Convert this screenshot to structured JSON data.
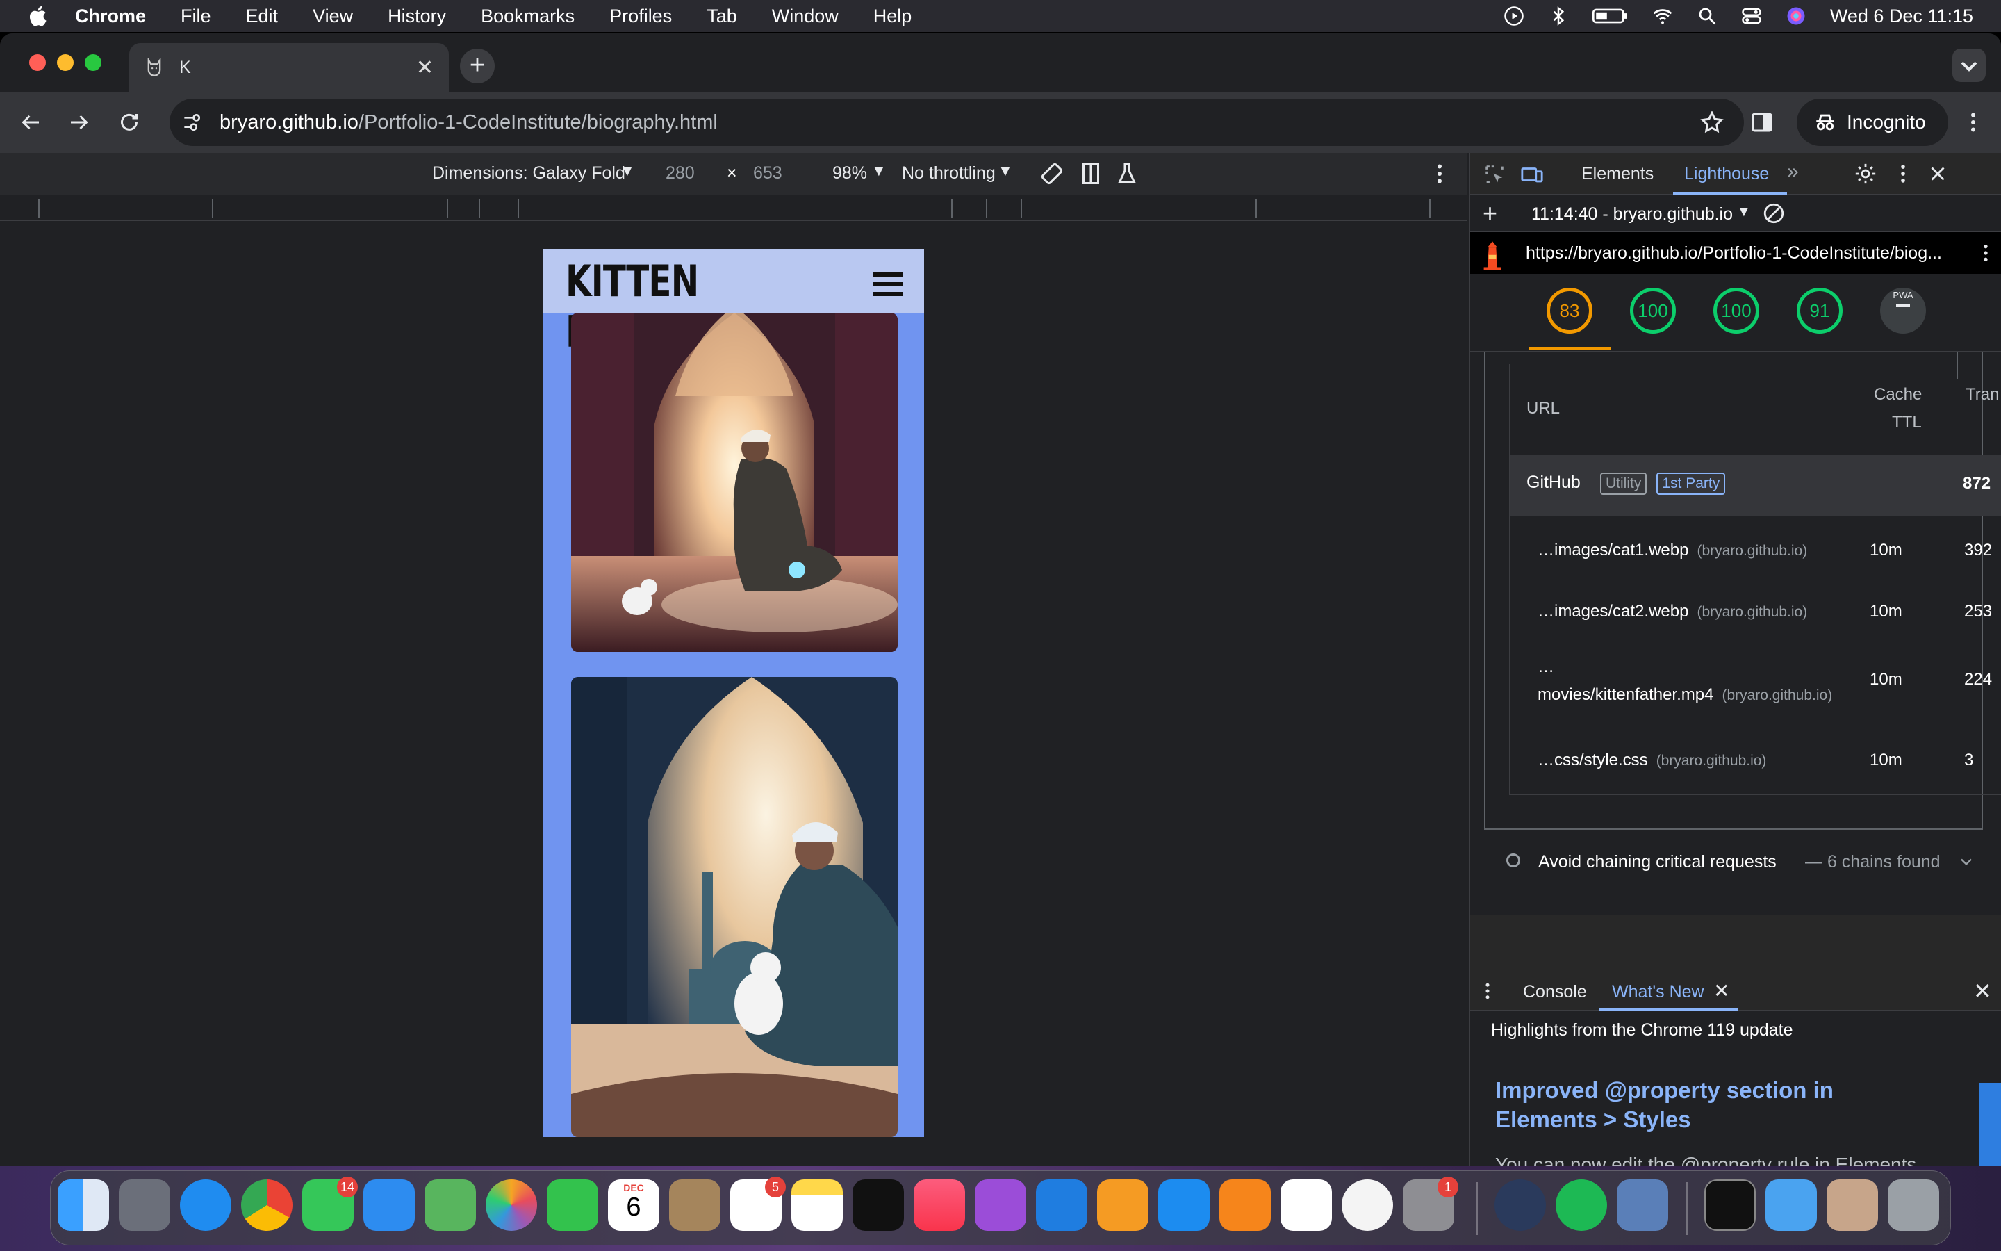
{
  "menubar": {
    "app": "Chrome",
    "items": [
      "File",
      "Edit",
      "View",
      "History",
      "Bookmarks",
      "Profiles",
      "Tab",
      "Window",
      "Help"
    ],
    "datetime": "Wed 6 Dec  11:15"
  },
  "browser": {
    "tab_title": "K",
    "url_host": "bryaro.github.io",
    "url_path": "/Portfolio-1-CodeInstitute/biography.html",
    "incognito_label": "Incognito"
  },
  "device_toolbar": {
    "dimensions_label": "Dimensions: Galaxy Fold",
    "width": "280",
    "times": "×",
    "height": "653",
    "zoom": "98%",
    "throttling": "No throttling"
  },
  "page": {
    "site_title": "KITTEN FATHER"
  },
  "devtools": {
    "tabs": [
      "Elements",
      "Lighthouse"
    ],
    "report_label": "11:14:40 - bryaro.github.io",
    "report_url": "https://bryaro.github.io/Portfolio-1-CodeInstitute/biog...",
    "scores": [
      {
        "value": "83",
        "color": "#f29900"
      },
      {
        "value": "100",
        "color": "#0cce6b"
      },
      {
        "value": "100",
        "color": "#0cce6b"
      },
      {
        "value": "91",
        "color": "#0cce6b"
      }
    ],
    "pwa_label": "PWA",
    "table": {
      "col_url": "URL",
      "col_cache_1": "Cache",
      "col_cache_2": "TTL",
      "col_transfer": "Tran",
      "group": {
        "name": "GitHub",
        "badge1": "Utility",
        "badge2": "1st Party",
        "size": "872"
      },
      "rows": [
        {
          "name": "…images/cat1.webp",
          "host": "(bryaro.github.io)",
          "ttl": "10m",
          "size": "392"
        },
        {
          "name": "…images/cat2.webp",
          "host": "(bryaro.github.io)",
          "ttl": "10m",
          "size": "253"
        },
        {
          "name_1": "…",
          "name": "movies/kittenfather.mp4",
          "host": "(bryaro.github.io)",
          "ttl": "10m",
          "size": "224"
        },
        {
          "name": "…css/style.css",
          "host": "(bryaro.github.io)",
          "ttl": "10m",
          "size": "3"
        }
      ]
    },
    "audit": {
      "title": "Avoid chaining critical requests",
      "detail": "— 6 chains found"
    },
    "drawer": {
      "tabs": [
        "Console",
        "What's New"
      ],
      "highlights": "Highlights from the Chrome 119 update",
      "headline": "Improved @property section in Elements > Styles",
      "text": "You can now edit the @property rule in Elements"
    }
  },
  "dock": {
    "messages_badge": "14",
    "reminders_badge": "5",
    "settings_badge": "1",
    "calendar_month": "DEC",
    "calendar_day": "6"
  }
}
